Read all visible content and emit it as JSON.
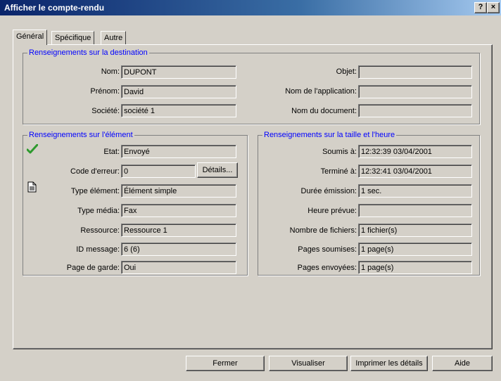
{
  "window": {
    "title": "Afficher le compte-rendu",
    "help_label": "?",
    "close_label": "×"
  },
  "tabs": [
    {
      "label": "Général",
      "active": true
    },
    {
      "label": "Spécifique",
      "active": false
    },
    {
      "label": "Autre",
      "active": false
    }
  ],
  "destination": {
    "legend": "Renseignements sur la destination",
    "nom_label": "Nom:",
    "nom_value": "DUPONT",
    "prenom_label": "Prénom:",
    "prenom_value": "David",
    "societe_label": "Société:",
    "societe_value": "société 1",
    "objet_label": "Objet:",
    "objet_value": "",
    "application_label": "Nom de l'application:",
    "application_value": "",
    "document_label": "Nom du document:",
    "document_value": ""
  },
  "element": {
    "legend": "Renseignements sur l'élément",
    "etat_label": "Etat:",
    "etat_value": "Envoyé",
    "erreur_label": "Code d'erreur:",
    "erreur_value": "0",
    "details_label": "Détails...",
    "type_label": "Type élément:",
    "type_value": "Élément simple",
    "media_label": "Type média:",
    "media_value": "Fax",
    "ressource_label": "Ressource:",
    "ressource_value": "Ressource  1",
    "message_label": "ID message:",
    "message_value": "6 (6)",
    "garde_label": "Page de garde:",
    "garde_value": "Oui"
  },
  "taille": {
    "legend": "Renseignements sur la taille et l'heure",
    "soumis_label": "Soumis à:",
    "soumis_value": "12:32:39  03/04/2001",
    "termine_label": "Terminé à:",
    "termine_value": "12:32:41  03/04/2001",
    "duree_label": "Durée émission:",
    "duree_value": "1 sec.",
    "prevue_label": "Heure prévue:",
    "prevue_value": "",
    "fichiers_label": "Nombre de fichiers:",
    "fichiers_value": "1 fichier(s)",
    "soumises_label": "Pages soumises:",
    "soumises_value": "1 page(s)",
    "envoyees_label": "Pages envoyées:",
    "envoyees_value": "1 page(s)"
  },
  "buttons": {
    "fermer": "Fermer",
    "visualiser": "Visualiser",
    "imprimer": "Imprimer les détails",
    "aide": "Aide"
  },
  "colors": {
    "legend": "#0000ff",
    "face": "#d4d0c8",
    "titlebar": "#0a246a",
    "check_icon": "#2e9a2e"
  },
  "icons": {
    "status": "checkmark-icon",
    "type": "document-icon"
  }
}
